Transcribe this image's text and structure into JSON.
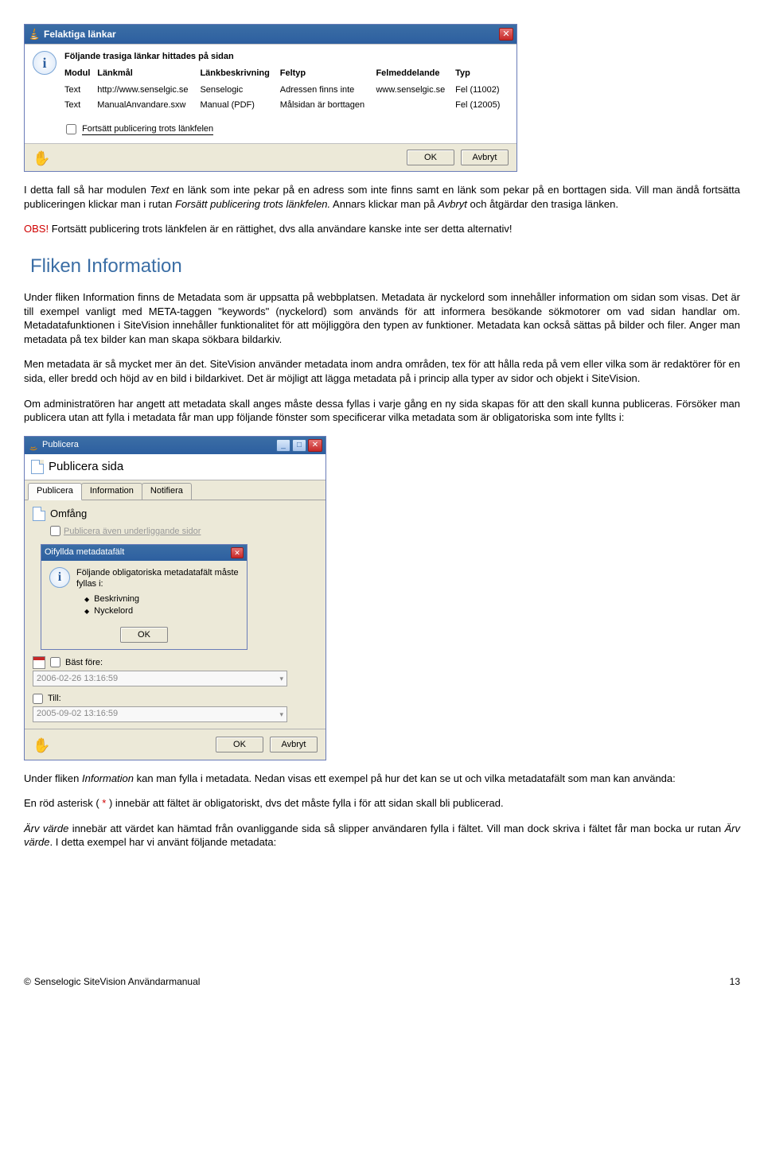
{
  "dlg1": {
    "title": "Felaktiga länkar",
    "intro": "Följande trasiga länkar hittades på sidan",
    "columns": [
      "Modul",
      "Länkmål",
      "Länkbeskrivning",
      "Feltyp",
      "Felmeddelande",
      "Typ"
    ],
    "rows": [
      {
        "modul": "Text",
        "mal": "http://www.senselgic.se",
        "beskr": "Senselogic",
        "feltyp": "Adressen finns inte",
        "felmed": "www.senselgic.se",
        "typ": "Fel (11002)"
      },
      {
        "modul": "Text",
        "mal": "ManualAnvandare.sxw",
        "beskr": "Manual (PDF)",
        "feltyp": "Målsidan är borttagen",
        "felmed": "",
        "typ": "Fel (12005)"
      }
    ],
    "checkbox": "Fortsätt publicering trots länkfelen",
    "ok": "OK",
    "cancel": "Avbryt"
  },
  "p1": "I detta fall så har modulen ",
  "p1_i": "Text",
  "p1_r": " en länk som inte pekar på en adress som inte finns samt en länk som pekar på en borttagen sida. Vill man ändå fortsätta publiceringen klickar man i rutan ",
  "p1_i2": "Forsätt publicering trots länkfelen.",
  "p1_r2": " Annars klickar man på ",
  "p1_i3": "Avbryt",
  "p1_r3": " och åtgärdar den trasiga länken.",
  "obs": "OBS!",
  "obsText": " Fortsätt publicering trots länkfelen är en rättighet, dvs alla användare kanske inte ser detta alternativ!",
  "h2": "Fliken Information",
  "p3": "Under fliken Information finns de Metadata som är uppsatta på webbplatsen. Metadata är nyckelord som innehåller information om sidan som visas. Det är till exempel vanligt med META-taggen \"keywords\" (nyckelord) som används för att informera besökande sökmotorer om vad sidan handlar om. Metadatafunktionen i SiteVision innehåller funktionalitet för att möjliggöra den typen av funktioner. Metadata kan också sättas på bilder och filer. Anger man metadata på tex bilder kan man skapa sökbara bildarkiv.",
  "p4": "Men metadata är så mycket mer än det. SiteVision använder metadata inom andra områden, tex för att hålla reda på vem eller vilka som är redaktörer för en sida, eller bredd och höjd av en bild i bildarkivet. Det är möjligt att lägga metadata på i princip alla typer av sidor och objekt i SiteVision.",
  "p5": "Om administratören har angett att metadata skall anges måste dessa fyllas i varje gång en ny sida skapas för att den skall kunna publiceras. Försöker man publicera utan att fylla i metadata får man upp följande fönster som specificerar vilka metadata som är obligatoriska som inte fyllts i:",
  "dlg2": {
    "title": "Publicera",
    "header": "Publicera sida",
    "tabs": [
      "Publicera",
      "Information",
      "Notifiera"
    ],
    "sectOmfang": "Omfång",
    "pubSub": "Publicera även underliggande sidor",
    "nested": {
      "title": "Oifyllda metadatafält",
      "msg": "Följande obligatoriska metadatafält måste fyllas i:",
      "items": [
        "Beskrivning",
        "Nyckelord"
      ],
      "ok": "OK"
    },
    "bastLabel": "Bäst före:",
    "bastVal": "2006-02-26 13:16:59",
    "tillLabel": "Till:",
    "tillVal": "2005-09-02 13:16:59",
    "ok": "OK",
    "cancel": "Avbryt"
  },
  "p7a": "Under fliken ",
  "p7i": "Information",
  "p7b": " kan man fylla i metadata. Nedan visas ett exempel på hur det kan se ut och vilka metadatafält som man kan använda:",
  "p8a": "En röd asterisk ( ",
  "p8star": "*",
  "p8b": " ) innebär att fältet är obligatoriskt, dvs det måste fylla i för att sidan skall bli publicerad.",
  "p9i1": "Ärv värde",
  "p9a": " innebär att värdet kan hämtad från ovanliggande sida så slipper användaren fylla i fältet. Vill man dock skriva i fältet får man bocka ur rutan ",
  "p9i2": "Ärv värde",
  "p9b": ". I detta exempel har vi använt följande metadata:",
  "footerCopy": "Senselogic SiteVision Användarmanual",
  "pageNum": "13"
}
